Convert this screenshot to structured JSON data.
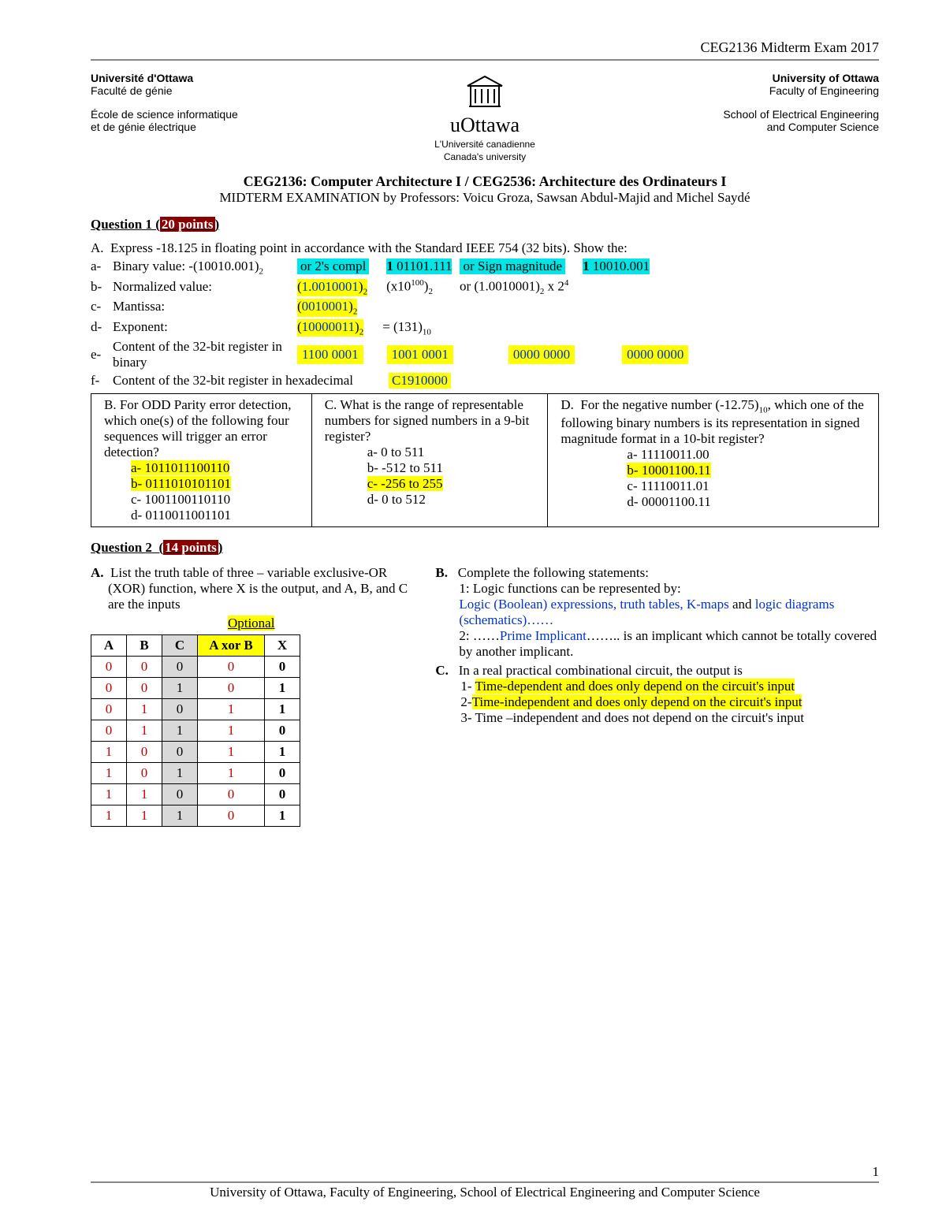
{
  "header": {
    "top_title": "CEG2136 Midterm Exam 2017",
    "left": {
      "uni_fr": "Université d'Ottawa",
      "fac_fr": "Faculté de génie",
      "school_fr_1": "École de science informatique",
      "school_fr_2": "et de génie électrique"
    },
    "center": {
      "logo_word": "uOttawa",
      "sub1": "L'Université canadienne",
      "sub2": "Canada's university"
    },
    "right": {
      "uni_en": "University of Ottawa",
      "fac_en": "Faculty of Engineering",
      "school_en_1": "School of Electrical Engineering",
      "school_en_2": "and Computer Science"
    }
  },
  "course_title": "CEG2136: Computer Architecture I / CEG2536: Architecture des Ordinateurs I",
  "profs": "MIDTERM EXAMINATION by Professors:  Voicu Groza, Sawsan Abdul-Majid and Michel Saydé",
  "q1": {
    "label": "Question 1",
    "points": "20 points",
    "A": "Express -18.125 in floating point in accordance with the Standard IEEE 754 (32 bits). Show the:",
    "a": {
      "label": "Binary value: -(10010.001)",
      "hc1": "or 2's compl",
      "v1": "1",
      "v1t": " 01101.111",
      "hc2": "or Sign magnitude",
      "v2": "1",
      "v2t": " 10010.001"
    },
    "b": {
      "label": "Normalized value:",
      "val1": "(1.0010001)",
      "val2a": "(x10",
      "val2b": "100",
      "val2c": ")",
      "val3": "or (1.0010001)2 x 2",
      "val3s": "4"
    },
    "c": {
      "label": "Mantissa:",
      "val": "0010001"
    },
    "d": {
      "label": "Exponent:",
      "val": "10000011",
      "eq": "= (131)"
    },
    "e": {
      "label": "Content of the 32-bit register in binary",
      "b1": "1100 0001",
      "b2": "1001 0001",
      "b3": "0000 0000",
      "b4": "0000 0000"
    },
    "f": {
      "label": "Content of the 32-bit register  in hexadecimal",
      "val": "C1910000"
    },
    "B": {
      "text": "B. For ODD Parity error detection, which one(s) of the following four sequences will trigger an error detection?",
      "a": "a-  1011011100110",
      "b": "b-  0111010101101",
      "c": "c-  1001100110110",
      "d": "d-  0110011001101"
    },
    "C": {
      "text": "C. What is the range of representable numbers for signed numbers in a 9-bit register?",
      "a": "a-     0     to 511",
      "b": "b-  -512 to 511",
      "c": "c-  -256 to 255",
      "d": "d-    0     to 512"
    },
    "D": {
      "text": "D.  For the negative number (-12.75)10, which one of the following binary numbers is its representation in signed magnitude format in a 10-bit register?",
      "a": "a-   11110011.00",
      "b": "b-   10001100.11",
      "c": "c-   11110011.01",
      "d": "d-   00001100.11"
    }
  },
  "q2": {
    "label": "Question 2",
    "points": "14 points",
    "A": "List the truth table of three – variable exclusive-OR (XOR) function, where X is the output, and A, B, and C are the inputs",
    "optional": "Optional",
    "th": {
      "A": "A",
      "B": "B",
      "C": "C",
      "AxorB": "A xor B",
      "X": "X"
    },
    "tt": [
      {
        "A": "0",
        "B": "0",
        "C": "0",
        "AxB": "0",
        "X": "0"
      },
      {
        "A": "0",
        "B": "0",
        "C": "1",
        "AxB": "0",
        "X": "1"
      },
      {
        "A": "0",
        "B": "1",
        "C": "0",
        "AxB": "1",
        "X": "1"
      },
      {
        "A": "0",
        "B": "1",
        "C": "1",
        "AxB": "1",
        "X": "0"
      },
      {
        "A": "1",
        "B": "0",
        "C": "0",
        "AxB": "1",
        "X": "1"
      },
      {
        "A": "1",
        "B": "0",
        "C": "1",
        "AxB": "1",
        "X": "0"
      },
      {
        "A": "1",
        "B": "1",
        "C": "0",
        "AxB": "0",
        "X": "0"
      },
      {
        "A": "1",
        "B": "1",
        "C": "1",
        "AxB": "0",
        "X": "1"
      }
    ],
    "B": {
      "label": "Complete the following statements:",
      "s1a": "1: Logic functions can be represented by:",
      "s1b": "Logic (Boolean) expressions, truth tables, K-maps",
      "s1c": " and  ",
      "s1d": "logic diagrams (schematics)……",
      "s2a": "2: ……",
      "s2b": "Prime Implicant",
      "s2c": "…….. is an implicant which cannot be totally covered by another implicant."
    },
    "C": {
      "label": "In a real practical combinational circuit, the output is",
      "o1": "Time-dependent and does only depend on the circuit's input",
      "o2": "Time-independent and does only depend on the circuit's input",
      "o3": "Time –independent and does not depend on the circuit's input"
    }
  },
  "footer": {
    "text": "University of Ottawa, Faculty of Engineering, School of Electrical Engineering and Computer Science",
    "page": "1"
  }
}
